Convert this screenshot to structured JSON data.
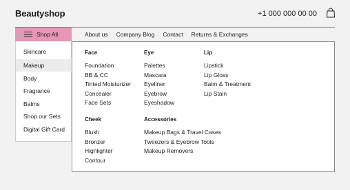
{
  "header": {
    "logo": "Beautyshop",
    "phone": "+1 000 000 00 00",
    "bag_icon": "shopping-bag-icon"
  },
  "nav": {
    "shop_all": "Shop All",
    "menu_icon": "hamburger-icon",
    "links": [
      "About us",
      "Company Blog",
      "Contact",
      "Returns & Exchanges"
    ]
  },
  "sidebar": {
    "items": [
      "Skincare",
      "Makeup",
      "Body",
      "Fragrance",
      "Balms",
      "Shop our Sets",
      "Digital Gift Card"
    ],
    "active": "Makeup"
  },
  "mega": {
    "face": {
      "title": "Face",
      "items": [
        "Foundation",
        "BB & CC",
        "Tinted Moisturizer",
        "Concealer",
        "Face Sets"
      ]
    },
    "eye": {
      "title": "Eye",
      "items": [
        "Palettes",
        "Mascara",
        "Eyeliner",
        "Eyebrow",
        "Eyeshadow"
      ]
    },
    "lip": {
      "title": "Lip",
      "items": [
        "Lipstick",
        "Lip Gloss",
        "Balm & Treatment",
        "Lip Stain"
      ]
    },
    "cheek": {
      "title": "Cheek",
      "items": [
        "Blush",
        "Bronzer",
        "Highlighter",
        "Contour"
      ]
    },
    "accessories": {
      "title": "Accessories",
      "items": [
        "Makeup Bags & Travel Cases",
        "Tweezers & Eyebrow Tools",
        "Makeup Removers"
      ]
    }
  },
  "colors": {
    "accent": "#e896b5",
    "active_bg": "#ececec"
  }
}
